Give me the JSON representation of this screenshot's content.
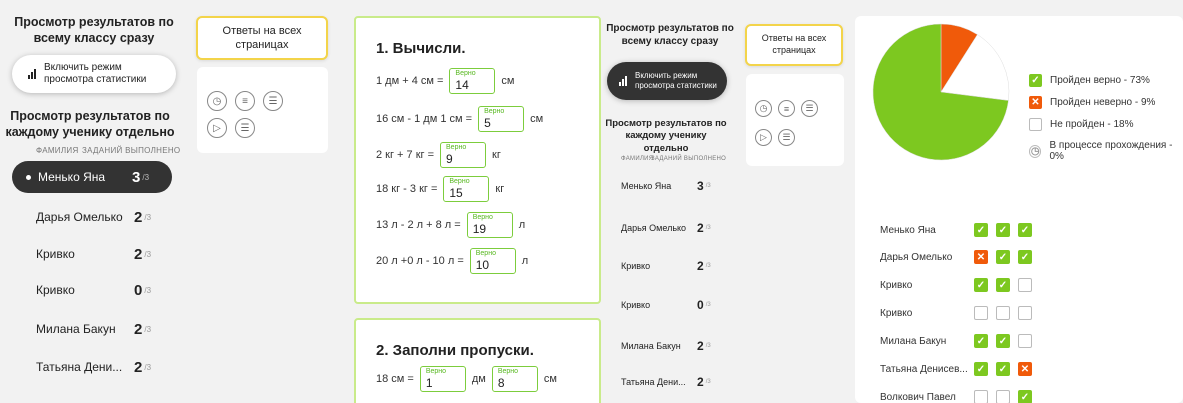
{
  "sidebar": {
    "title_all": "Просмотр результатов по всему классу сразу",
    "stats_button": "Включить режим просмотра статистики",
    "title_each": "Просмотр результатов по каждому ученику отдельно",
    "col_surname": "ФАМИЛИЯ",
    "col_done": "ЗАДАНИЙ ВЫПОЛНЕНО",
    "of_total": "/3",
    "students": [
      {
        "name": "Менько Яна",
        "score": "3"
      },
      {
        "name": "Дарья Омелько",
        "score": "2"
      },
      {
        "name": "Кривко",
        "score": "2"
      },
      {
        "name": "Кривко",
        "score": "0"
      },
      {
        "name": "Милана Бакун",
        "score": "2"
      },
      {
        "name": "Татьяна Дени...",
        "score": "2"
      }
    ]
  },
  "answers_all_button": "Ответы на всех страницах",
  "tools": [
    "clock-icon",
    "text-align-icon",
    "checklist-icon",
    "play-icon",
    "list-icon"
  ],
  "task1": {
    "title": "1. Вычисли.",
    "correct_label": "Верно",
    "items": [
      {
        "expr": "1 дм + 4 см =",
        "answer": "14",
        "unit": "см"
      },
      {
        "expr": "16 см - 1 дм 1 см =",
        "answer": "5",
        "unit": "см"
      },
      {
        "expr": "2 кг + 7 кг =",
        "answer": "9",
        "unit": "кг"
      },
      {
        "expr": "18 кг - 3 кг =",
        "answer": "15",
        "unit": "кг"
      },
      {
        "expr": "13 л - 2 л + 8 л =",
        "answer": "19",
        "unit": "л"
      },
      {
        "expr": "20 л +0 л - 10 л =",
        "answer": "10",
        "unit": "л"
      }
    ]
  },
  "task2": {
    "title": "2. Заполни пропуски.",
    "prefix": "18 см =",
    "answer1": "1",
    "mid": "дм",
    "answer2": "8",
    "unit": "см"
  },
  "stats": {
    "legend": [
      {
        "label": "Пройден верно - 73%",
        "kind": "ok"
      },
      {
        "label": "Пройден неверно - 9%",
        "kind": "bad"
      },
      {
        "label": "Не пройден - 18%",
        "kind": "empty"
      },
      {
        "label": "В процессе прохождения - 0%",
        "kind": "wait"
      }
    ],
    "colors": {
      "ok": "#7dc820",
      "bad": "#f05a0a",
      "empty": "#ffffff"
    },
    "pie": {
      "ok": 73,
      "bad": 9,
      "empty": 18
    },
    "grid": [
      {
        "name": "Менько Яна",
        "marks": [
          "ok",
          "ok",
          "ok"
        ]
      },
      {
        "name": "Дарья Омелько",
        "marks": [
          "bad",
          "ok",
          "ok"
        ]
      },
      {
        "name": "Кривко",
        "marks": [
          "ok",
          "ok",
          "empty"
        ]
      },
      {
        "name": "Кривко",
        "marks": [
          "empty",
          "empty",
          "empty"
        ]
      },
      {
        "name": "Милана Бакун",
        "marks": [
          "ok",
          "ok",
          "empty"
        ]
      },
      {
        "name": "Татьяна Денисев...",
        "marks": [
          "ok",
          "ok",
          "bad"
        ]
      },
      {
        "name": "Волкович Павел",
        "marks": [
          "empty",
          "empty",
          "ok"
        ]
      }
    ]
  }
}
